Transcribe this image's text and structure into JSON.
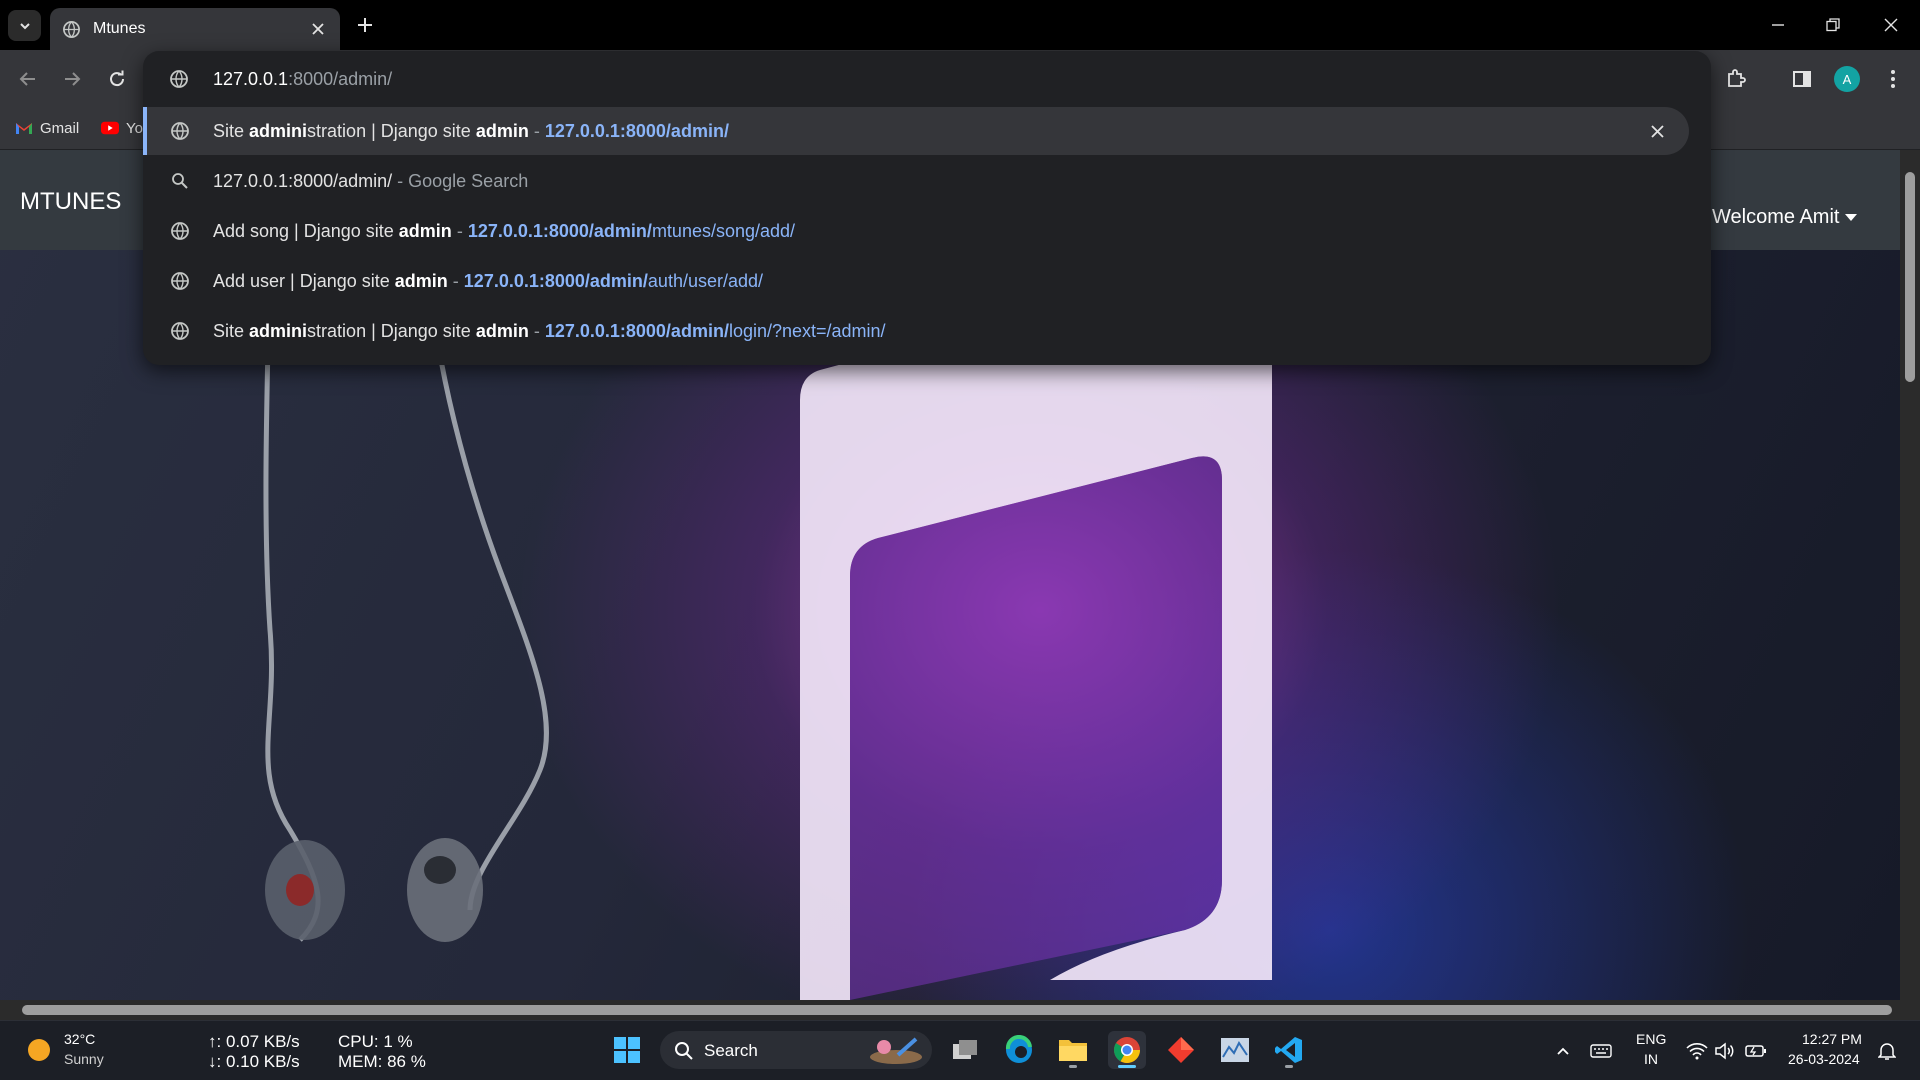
{
  "browser": {
    "tab": {
      "title": "Mtunes"
    },
    "bookmarks": [
      {
        "label": "Gmail"
      },
      {
        "label": "Yo"
      }
    ],
    "profile_initial": "A"
  },
  "omnibox": {
    "input_host": "127.0.0.1",
    "input_rest": ":8000/admin/",
    "suggestions": [
      {
        "type": "history",
        "title_parts": [
          "Site ",
          "admini",
          "stration | Django site ",
          "admin"
        ],
        "separator": " - ",
        "url_bold": "127.0.0.1:8000/admin/",
        "url_rest": ""
      },
      {
        "type": "search",
        "query": "127.0.0.1:8000/admin/",
        "suffix": " - Google Search"
      },
      {
        "type": "history",
        "title_parts": [
          "Add song | Django site ",
          "admin"
        ],
        "separator": " - ",
        "url_bold": "127.0.0.1:8000/admin/",
        "url_rest": "mtunes/song/add/"
      },
      {
        "type": "history",
        "title_parts": [
          "Add user | Django site ",
          "admin"
        ],
        "separator": " - ",
        "url_bold": "127.0.0.1:8000/admin/",
        "url_rest": "auth/user/add/"
      },
      {
        "type": "history",
        "title_parts": [
          "Site ",
          "admini",
          "stration | Django site ",
          "admin"
        ],
        "separator": " - ",
        "url_bold": "127.0.0.1:8000/admin/",
        "url_rest": "login/?next=/admin/"
      }
    ]
  },
  "site": {
    "brand": "MTUNES",
    "welcome": "Welcome Amit"
  },
  "taskbar": {
    "weather": {
      "temp": "32°C",
      "condition": "Sunny"
    },
    "net": {
      "up": "↑: 0.07 KB/s",
      "down": "↓: 0.10 KB/s"
    },
    "cpu": "CPU: 1 %",
    "mem": "MEM: 86 %",
    "search_label": "Search",
    "lang": {
      "top": "ENG",
      "bottom": "IN"
    },
    "time": "12:27 PM",
    "date": "26-03-2024"
  },
  "colors": {
    "accent_blue": "#8ab4f8",
    "chrome_dark": "#35363a",
    "omnibox_bg": "#202124",
    "site_nav": "#343a40",
    "avatar": "#13a3a3"
  }
}
